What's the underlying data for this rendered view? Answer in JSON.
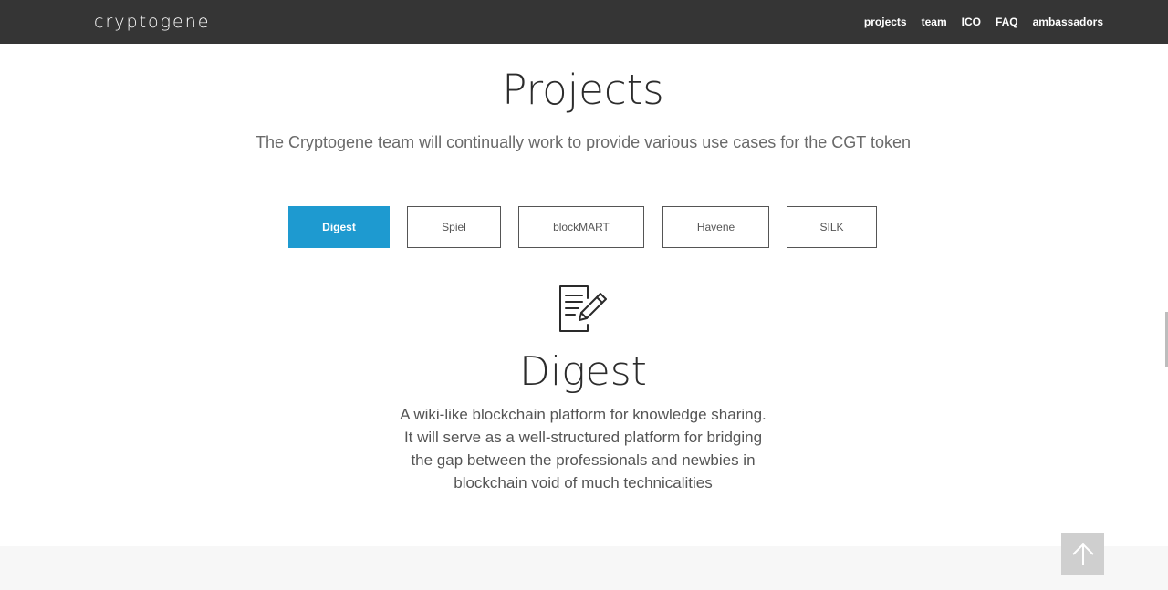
{
  "header": {
    "logo_text": "cryptogene",
    "nav": [
      {
        "label": "projects"
      },
      {
        "label": "team"
      },
      {
        "label": "ICO"
      },
      {
        "label": "FAQ"
      },
      {
        "label": "ambassadors"
      }
    ]
  },
  "section": {
    "title": "Projects",
    "subtitle": "The Cryptogene team will continually work to provide various use cases for the CGT token"
  },
  "tabs": [
    {
      "label": "Digest",
      "active": true
    },
    {
      "label": "Spiel",
      "active": false
    },
    {
      "label": "blockMART",
      "active": false
    },
    {
      "label": "Havene",
      "active": false
    },
    {
      "label": "SILK",
      "active": false
    }
  ],
  "project": {
    "icon": "document-edit-icon",
    "title": "Digest",
    "description_lines": [
      "A wiki-like blockchain platform for knowledge sharing.",
      "It will serve as a well-structured platform for bridging",
      "the gap between the professionals and newbies in",
      "blockchain void of much technicalities"
    ]
  },
  "colors": {
    "topbar": "#353535",
    "accent": "#1e9ad0",
    "scroll_top_button": "#cfcfcf"
  },
  "icons": {
    "scroll_top": "arrow-up-icon"
  }
}
